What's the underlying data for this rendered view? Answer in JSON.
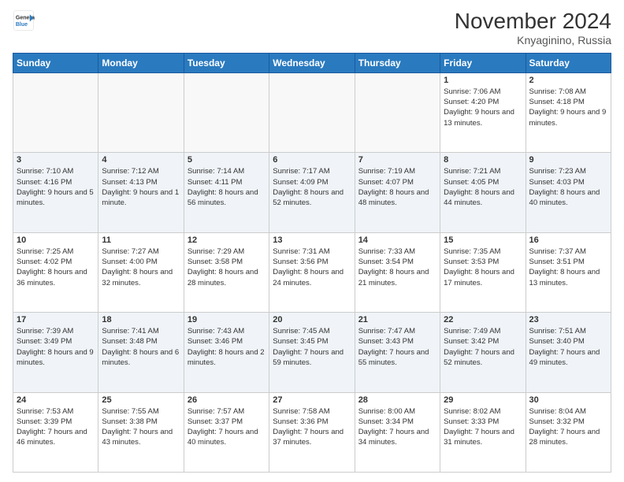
{
  "header": {
    "logo_line1": "General",
    "logo_line2": "Blue",
    "title": "November 2024",
    "subtitle": "Knyaginino, Russia"
  },
  "days_of_week": [
    "Sunday",
    "Monday",
    "Tuesday",
    "Wednesday",
    "Thursday",
    "Friday",
    "Saturday"
  ],
  "weeks": [
    [
      {
        "day": "",
        "info": ""
      },
      {
        "day": "",
        "info": ""
      },
      {
        "day": "",
        "info": ""
      },
      {
        "day": "",
        "info": ""
      },
      {
        "day": "",
        "info": ""
      },
      {
        "day": "1",
        "info": "Sunrise: 7:06 AM\nSunset: 4:20 PM\nDaylight: 9 hours and 13 minutes."
      },
      {
        "day": "2",
        "info": "Sunrise: 7:08 AM\nSunset: 4:18 PM\nDaylight: 9 hours and 9 minutes."
      }
    ],
    [
      {
        "day": "3",
        "info": "Sunrise: 7:10 AM\nSunset: 4:16 PM\nDaylight: 9 hours and 5 minutes."
      },
      {
        "day": "4",
        "info": "Sunrise: 7:12 AM\nSunset: 4:13 PM\nDaylight: 9 hours and 1 minute."
      },
      {
        "day": "5",
        "info": "Sunrise: 7:14 AM\nSunset: 4:11 PM\nDaylight: 8 hours and 56 minutes."
      },
      {
        "day": "6",
        "info": "Sunrise: 7:17 AM\nSunset: 4:09 PM\nDaylight: 8 hours and 52 minutes."
      },
      {
        "day": "7",
        "info": "Sunrise: 7:19 AM\nSunset: 4:07 PM\nDaylight: 8 hours and 48 minutes."
      },
      {
        "day": "8",
        "info": "Sunrise: 7:21 AM\nSunset: 4:05 PM\nDaylight: 8 hours and 44 minutes."
      },
      {
        "day": "9",
        "info": "Sunrise: 7:23 AM\nSunset: 4:03 PM\nDaylight: 8 hours and 40 minutes."
      }
    ],
    [
      {
        "day": "10",
        "info": "Sunrise: 7:25 AM\nSunset: 4:02 PM\nDaylight: 8 hours and 36 minutes."
      },
      {
        "day": "11",
        "info": "Sunrise: 7:27 AM\nSunset: 4:00 PM\nDaylight: 8 hours and 32 minutes."
      },
      {
        "day": "12",
        "info": "Sunrise: 7:29 AM\nSunset: 3:58 PM\nDaylight: 8 hours and 28 minutes."
      },
      {
        "day": "13",
        "info": "Sunrise: 7:31 AM\nSunset: 3:56 PM\nDaylight: 8 hours and 24 minutes."
      },
      {
        "day": "14",
        "info": "Sunrise: 7:33 AM\nSunset: 3:54 PM\nDaylight: 8 hours and 21 minutes."
      },
      {
        "day": "15",
        "info": "Sunrise: 7:35 AM\nSunset: 3:53 PM\nDaylight: 8 hours and 17 minutes."
      },
      {
        "day": "16",
        "info": "Sunrise: 7:37 AM\nSunset: 3:51 PM\nDaylight: 8 hours and 13 minutes."
      }
    ],
    [
      {
        "day": "17",
        "info": "Sunrise: 7:39 AM\nSunset: 3:49 PM\nDaylight: 8 hours and 9 minutes."
      },
      {
        "day": "18",
        "info": "Sunrise: 7:41 AM\nSunset: 3:48 PM\nDaylight: 8 hours and 6 minutes."
      },
      {
        "day": "19",
        "info": "Sunrise: 7:43 AM\nSunset: 3:46 PM\nDaylight: 8 hours and 2 minutes."
      },
      {
        "day": "20",
        "info": "Sunrise: 7:45 AM\nSunset: 3:45 PM\nDaylight: 7 hours and 59 minutes."
      },
      {
        "day": "21",
        "info": "Sunrise: 7:47 AM\nSunset: 3:43 PM\nDaylight: 7 hours and 55 minutes."
      },
      {
        "day": "22",
        "info": "Sunrise: 7:49 AM\nSunset: 3:42 PM\nDaylight: 7 hours and 52 minutes."
      },
      {
        "day": "23",
        "info": "Sunrise: 7:51 AM\nSunset: 3:40 PM\nDaylight: 7 hours and 49 minutes."
      }
    ],
    [
      {
        "day": "24",
        "info": "Sunrise: 7:53 AM\nSunset: 3:39 PM\nDaylight: 7 hours and 46 minutes."
      },
      {
        "day": "25",
        "info": "Sunrise: 7:55 AM\nSunset: 3:38 PM\nDaylight: 7 hours and 43 minutes."
      },
      {
        "day": "26",
        "info": "Sunrise: 7:57 AM\nSunset: 3:37 PM\nDaylight: 7 hours and 40 minutes."
      },
      {
        "day": "27",
        "info": "Sunrise: 7:58 AM\nSunset: 3:36 PM\nDaylight: 7 hours and 37 minutes."
      },
      {
        "day": "28",
        "info": "Sunrise: 8:00 AM\nSunset: 3:34 PM\nDaylight: 7 hours and 34 minutes."
      },
      {
        "day": "29",
        "info": "Sunrise: 8:02 AM\nSunset: 3:33 PM\nDaylight: 7 hours and 31 minutes."
      },
      {
        "day": "30",
        "info": "Sunrise: 8:04 AM\nSunset: 3:32 PM\nDaylight: 7 hours and 28 minutes."
      }
    ]
  ]
}
